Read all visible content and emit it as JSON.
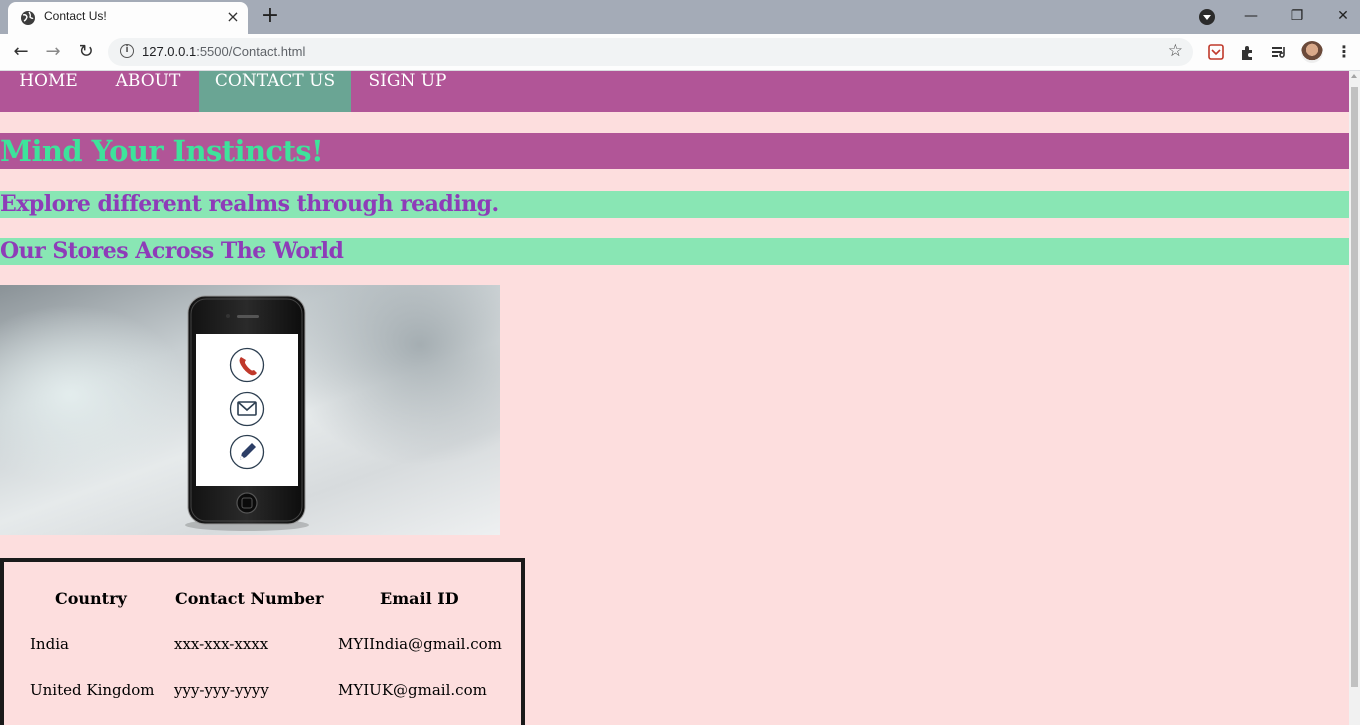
{
  "browser": {
    "tab_title": "Contact Us!",
    "tab_close": "×",
    "new_tab": "+",
    "url_host": "127.0.0.1",
    "url_rest": ":5500/Contact.html",
    "icons": [
      "globe-icon",
      "back-icon",
      "forward-icon",
      "reload-icon",
      "info-icon",
      "star-icon",
      "pocket-icon",
      "extensions-icon",
      "reading-list-icon",
      "avatar",
      "menu-icon",
      "minimize-icon",
      "restore-icon",
      "close-icon"
    ]
  },
  "nav": {
    "items": [
      {
        "label": "HOME"
      },
      {
        "label": "ABOUT"
      },
      {
        "label": "CONTACT US"
      },
      {
        "label": "SIGN UP"
      }
    ],
    "active_index": 2
  },
  "page": {
    "title": "Mind Your Instincts!",
    "tagline": "Explore different realms through reading.",
    "stores_heading": "Our Stores Across The World"
  },
  "table": {
    "headers": [
      "Country",
      "Contact Number",
      "Email ID"
    ],
    "rows": [
      [
        "India",
        "xxx-xxx-xxxx",
        "MYIIndia@gmail.com"
      ],
      [
        "United Kingdom",
        "yyy-yyy-yyyy",
        "MYIUK@gmail.com"
      ]
    ]
  },
  "colors": {
    "nav_bg": "#b15597",
    "nav_active": "#6aa594",
    "page_bg": "#fddede",
    "title_text": "#3ee39b",
    "subheading_bg": "#89e6b4",
    "subheading_text": "#8e3cb8"
  }
}
